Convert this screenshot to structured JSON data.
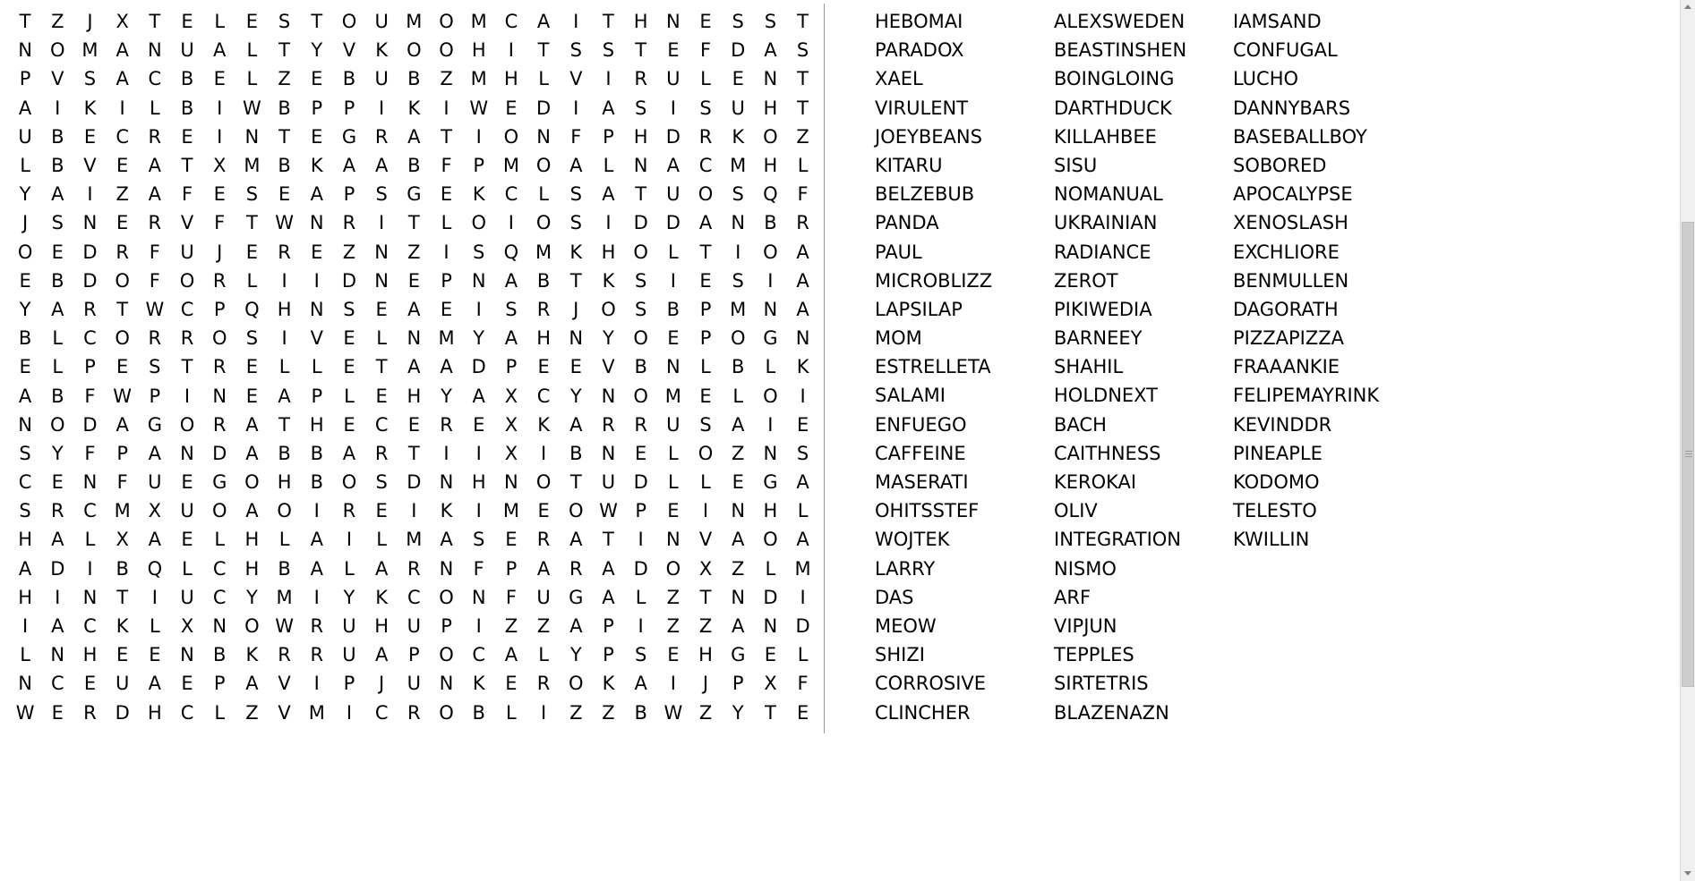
{
  "puzzle": {
    "type": "word-search",
    "grid_rows": 25,
    "grid_cols": 24,
    "grid": [
      "TZJXTELESTOUMOMCAITHNESST",
      "NOMANUALTYVKOOHITSSTEFDAS",
      "PVSACBELZEBUBZMHLVIRULENT",
      "AIKILBIWBPPIKIWEDIASISUHT",
      "UBECREINTEGRATIONFPHDRKOZ",
      "LBVEATXMBKAABFPMOALNACMHL",
      "YAIZAFESEAPSGEKCLSATUOSQF",
      "JSNERVFTWNRITLOIOSIDDANBR",
      "OEDRFUJEREZNZISQMKHOLTIOA",
      "EBDOFORLIIDNEPNABTKSIESIA",
      "YARTWCPQHNSEAEISRJOSBPMNA",
      "BLCORROSIVELNMYAHNYOEPOGN",
      "ELPESTRELLETAADPEEVBNLBLK",
      "ABFWPINEAPLEHYAXCYNOMELOI",
      "NODAGORATHECEREXKARRUSAIE",
      "SYFPANDABBARTIIXIBNELOZNS",
      "CENFUEGOHBOSDNHNOTUDLLEGA",
      "SRCMXUOAOIREIKIMEOWPEINHL",
      "HALXAELHLAILMASERATINVAOA",
      "ADIBQLCHBALARNFPARADOXZLM",
      "HINTIUCYMIYKCONFUGALZTNDI",
      "IACKLXNOWRUHUPIZZAPIZZAND",
      "LNHEENBKRRUAPOCALYPSEHGEL",
      "NCEUAEPAVIPJUNKEROKAIJPXF",
      "WERDHCLZVMICROBLIZZBWZYTE"
    ],
    "word_columns": [
      [
        "HEBOMAI",
        "PARADOX",
        "XAEL",
        "VIRULENT",
        "JOEYBEANS",
        "KITARU",
        "BELZEBUB",
        "PANDA",
        "PAUL",
        "MICROBLIZZ",
        "LAPSILAP",
        "MOM",
        "ESTRELLETA",
        "SALAMI",
        "ENFUEGO",
        "CAFFEINE",
        "MASERATI",
        "OHITSSTEF",
        "WOJTEK",
        "LARRY",
        "DAS",
        "MEOW",
        "SHIZI",
        "CORROSIVE",
        "CLINCHER"
      ],
      [
        "ALEXSWEDEN",
        "BEASTINSHEN",
        "BOINGLOING",
        "DARTHDUCK",
        "KILLAHBEE",
        "SISU",
        "NOMANUAL",
        "UKRAINIAN",
        "RADIANCE",
        "ZEROT",
        "PIKIWEDIA",
        "BARNEEY",
        "SHAHIL",
        "HOLDNEXT",
        "BACH",
        "CAITHNESS",
        "KEROKAI",
        "OLIV",
        "INTEGRATION",
        "NISMO",
        "ARF",
        "VIPJUN",
        "TEPPLES",
        "SIRTETRIS",
        "BLAZENAZN"
      ],
      [
        "IAMSAND",
        "CONFUGAL",
        "LUCHO",
        "DANNYBARS",
        "BASEBALLBOY",
        "SOBORED",
        "APOCALYPSE",
        "XENOSLASH",
        "EXCHLIORE",
        "BENMULLEN",
        "DAGORATH",
        "PIZZAPIZZA",
        "FRAAANKIE",
        "FELIPEMAYRINK",
        "KEVINDDR",
        "PINEAPLE",
        "KODOMO",
        "TELESTO",
        "KWILLIN"
      ]
    ]
  },
  "scrollbar": {
    "up_arrow": "scroll-up-arrow",
    "down_arrow": "scroll-down-arrow",
    "thumb": "scroll-thumb"
  }
}
